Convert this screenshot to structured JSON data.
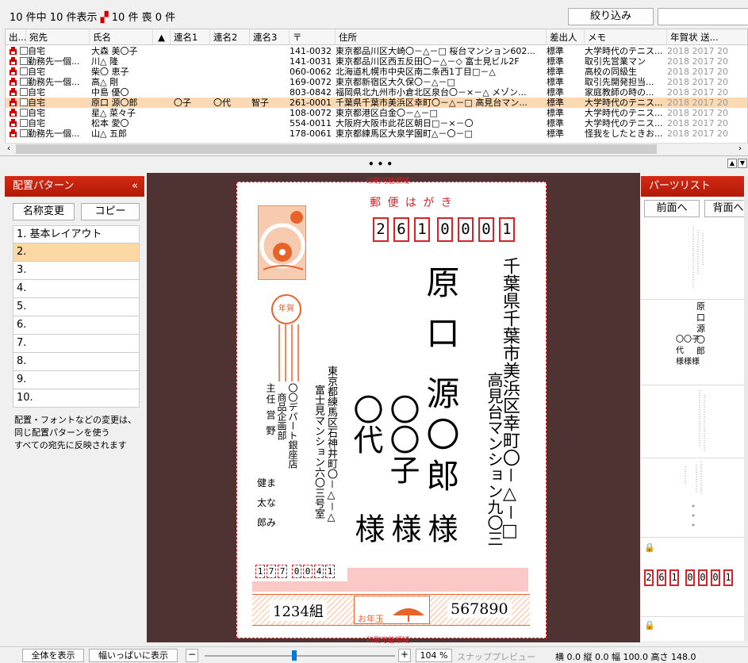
{
  "toolbar": {
    "count": "10 件中 10 件表示",
    "sent_count": "10 件",
    "mourning_count": "0 件",
    "filter_button": "絞り込み"
  },
  "table": {
    "headers": [
      "出...",
      "宛先",
      "氏名",
      "▲",
      "連名1",
      "連名2",
      "連名3",
      "〒",
      "住所",
      "差出人",
      "メモ",
      "年賀状 送..."
    ],
    "rows": [
      {
        "dest": "自宅",
        "name": "大森 美〇子",
        "ren1": "",
        "ren2": "",
        "ren3": "",
        "zip": "141-0032",
        "addr": "東京都品川区大崎〇－△－□ 桜台マンション602...",
        "sender": "標準",
        "memo": "大学時代のテニス...",
        "years": "2018 2017 20",
        "sel": false
      },
      {
        "dest": "勤務先一個...",
        "name": "川△ 隆",
        "ren1": "",
        "ren2": "",
        "ren3": "",
        "zip": "141-0031",
        "addr": "東京都品川区西五反田〇－△－◇ 富士見ビル2F",
        "sender": "標準",
        "memo": "取引先営業マン",
        "years": "2018 2017 20",
        "sel": false
      },
      {
        "dest": "自宅",
        "name": "柴〇 恵子",
        "ren1": "",
        "ren2": "",
        "ren3": "",
        "zip": "060-0062",
        "addr": "北海道札幌市中央区南二条西1丁目□－△",
        "sender": "標準",
        "memo": "高校の同級生",
        "years": "2018 2017 20",
        "sel": false
      },
      {
        "dest": "勤務先一個...",
        "name": "高△ 剛",
        "ren1": "",
        "ren2": "",
        "ren3": "",
        "zip": "169-0072",
        "addr": "東京都新宿区大久保〇－△－□",
        "sender": "標準",
        "memo": "取引先開発担当...",
        "years": "2018 2017 20",
        "sel": false
      },
      {
        "dest": "自宅",
        "name": "中島 優〇",
        "ren1": "",
        "ren2": "",
        "ren3": "",
        "zip": "803-0842",
        "addr": "福岡県北九州市小倉北区泉台〇－×－△ メゾン...",
        "sender": "標準",
        "memo": "家庭教師の時の...",
        "years": "2018 2017 20",
        "sel": false
      },
      {
        "dest": "自宅",
        "name": "原口 源〇郎",
        "ren1": "〇子",
        "ren2": "〇代",
        "ren3": "智子",
        "zip": "261-0001",
        "addr": "千葉県千葉市美浜区幸町〇－△－□ 高見台マン...",
        "sender": "標準",
        "memo": "大学時代のテニス...",
        "years": "2018 2017 20",
        "sel": true
      },
      {
        "dest": "自宅",
        "name": "星△ 菜々子",
        "ren1": "",
        "ren2": "",
        "ren3": "",
        "zip": "108-0072",
        "addr": "東京都港区白金〇－△－□",
        "sender": "標準",
        "memo": "大学時代のテニス...",
        "years": "2018 2017 20",
        "sel": false
      },
      {
        "dest": "自宅",
        "name": "松本 愛〇",
        "ren1": "",
        "ren2": "",
        "ren3": "",
        "zip": "554-0011",
        "addr": "大阪府大阪市此花区朝日□－×－〇",
        "sender": "標準",
        "memo": "大学時代のテニス...",
        "years": "2018 2017 20",
        "sel": false
      },
      {
        "dest": "勤務先一個...",
        "name": "山△ 五郎",
        "ren1": "",
        "ren2": "",
        "ren3": "",
        "zip": "178-0061",
        "addr": "東京都練馬区大泉学園町△－〇－□",
        "sender": "標準",
        "memo": "怪我をしたときお...",
        "years": "2018 2017 20",
        "sel": false
      }
    ]
  },
  "left_panel": {
    "title": "配置パターン",
    "rename_button": "名称変更",
    "copy_button": "コピー",
    "patterns": [
      "1. 基本レイアウト",
      "2.",
      "3.",
      "4.",
      "5.",
      "6.",
      "7.",
      "8.",
      "9.",
      "10."
    ],
    "note": [
      "配置・フォントなどの変更は、",
      "同じ配置パターンを使う",
      "すべての宛先に反映されます"
    ]
  },
  "card": {
    "print_area_top": "印刷可能領域",
    "print_area_bottom": "印刷可能領域",
    "postcard_label": "郵 便 は が き",
    "zip_digits": [
      "2",
      "6",
      "1",
      "0",
      "0",
      "0",
      "1"
    ],
    "address_line1": "千葉県千葉市美浜区幸町〇－△－□",
    "address_line2": "高見台マンション九〇三",
    "recipient_surname": "原口",
    "recipient_given": "源〇郎",
    "joint_name1": "〇〇子",
    "joint_name2": "〇代",
    "honorific": "様",
    "sender_address1": "東京都練馬区石神井町〇－△－△",
    "sender_address2": "富士見マンション六〇三号室",
    "sender_company": "〇〇デパート銀座店",
    "sender_dept": "商品企画部",
    "sender_title": "主任 営 野",
    "sender_family": [
      "健ま",
      "太な",
      "郎み"
    ],
    "sender_zip_digits": [
      "1",
      "7",
      "7",
      "0",
      "0",
      "4",
      "1"
    ],
    "lottery_group": "1234組",
    "lottery_number": "567890",
    "otoshidama_label": "お年玉",
    "nenga_label": "年賀"
  },
  "right_panel": {
    "title": "パーツリスト",
    "front_button": "前面へ",
    "back_button": "背面へ",
    "thumb_name": [
      "原",
      "口",
      "源",
      "〇",
      "郎"
    ],
    "thumb_joint": [
      "〇〇子",
      "代",
      "様様様"
    ],
    "thumb_zip_digits": [
      "2",
      "6",
      "1",
      "0",
      "0",
      "0",
      "1"
    ]
  },
  "bottom_bar": {
    "fit_all": "全体を表示",
    "fit_width": "幅いっぱいに表示",
    "zoom": "104 %",
    "snap": "スナップ",
    "preview": "プレビュー",
    "coords": "横 0.0 縦 0.0 幅 100.0 高さ 148.0"
  },
  "colors": {
    "accent_red": "#d8222a",
    "selected_row": "#fad9b3",
    "canvas_bg": "#4f3332",
    "lottery_band": "#e8632a"
  }
}
